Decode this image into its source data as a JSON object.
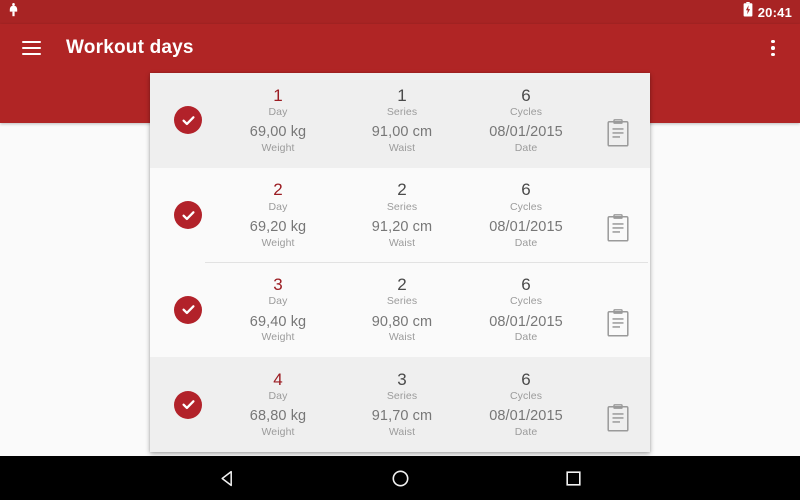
{
  "status_bar": {
    "notification_icon": "notification-dot-icon",
    "battery_icon": "battery-charging-icon",
    "time": "20:41"
  },
  "app_bar": {
    "menu_icon": "hamburger-menu-icon",
    "title": "Workout days",
    "overflow_icon": "overflow-menu-icon",
    "background_color": "#b02525"
  },
  "colors": {
    "primary_red": "#b02525",
    "status_red": "#a82424",
    "accent_day": "#9b1c22",
    "check_circle": "#b2222a",
    "card_background": "#fafafa",
    "row_shaded": "#efefef",
    "label_gray": "#9b9b9b"
  },
  "labels": {
    "day": "Day",
    "series": "Series",
    "cycles": "Cycles",
    "weight": "Weight",
    "waist": "Waist",
    "date": "Date"
  },
  "list": {
    "rows": [
      {
        "checked": true,
        "day": "1",
        "series": "1",
        "cycles": "6",
        "weight": "69,00 kg",
        "waist": "91,00 cm",
        "date": "08/01/2015",
        "note_icon": "clipboard-note-icon"
      },
      {
        "checked": true,
        "day": "2",
        "series": "2",
        "cycles": "6",
        "weight": "69,20 kg",
        "waist": "91,20 cm",
        "date": "08/01/2015",
        "note_icon": "clipboard-note-icon"
      },
      {
        "checked": true,
        "day": "3",
        "series": "2",
        "cycles": "6",
        "weight": "69,40 kg",
        "waist": "90,80 cm",
        "date": "08/01/2015",
        "note_icon": "clipboard-note-icon"
      },
      {
        "checked": true,
        "day": "4",
        "series": "3",
        "cycles": "6",
        "weight": "68,80 kg",
        "waist": "91,70 cm",
        "date": "08/01/2015",
        "note_icon": "clipboard-note-icon"
      }
    ]
  },
  "nav_bar": {
    "back_icon": "back-triangle-icon",
    "home_icon": "home-circle-icon",
    "recents_icon": "recents-square-icon"
  }
}
